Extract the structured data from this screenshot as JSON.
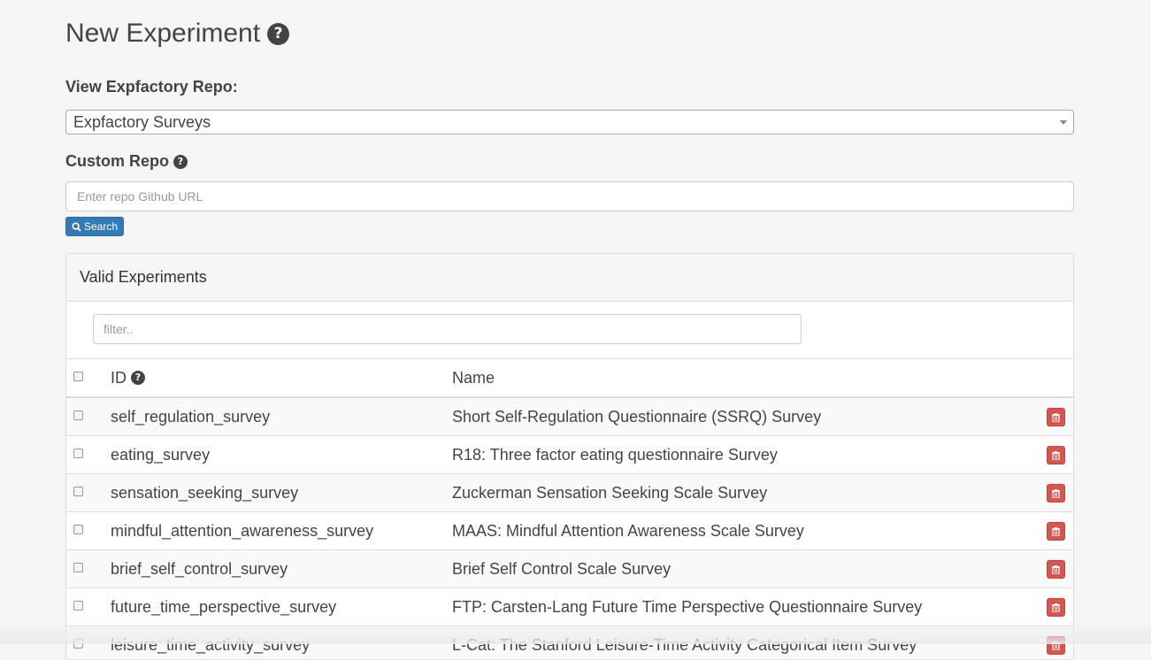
{
  "page": {
    "title": "New Experiment",
    "title_help_icon": "question-circle-icon"
  },
  "repo": {
    "label": "View Expfactory Repo:",
    "selected": "Expfactory Surveys"
  },
  "custom_repo": {
    "label": "Custom Repo",
    "help_icon": "question-circle-icon",
    "placeholder": "Enter repo Github URL",
    "search_label": "Search"
  },
  "panel": {
    "title": "Valid Experiments",
    "filter_placeholder": "filter.."
  },
  "table": {
    "columns": {
      "id": "ID",
      "name": "Name"
    },
    "rows": [
      {
        "id": "self_regulation_survey",
        "name": "Short Self-Regulation Questionnaire (SSRQ) Survey"
      },
      {
        "id": "eating_survey",
        "name": "R18: Three factor eating questionnaire Survey"
      },
      {
        "id": "sensation_seeking_survey",
        "name": "Zuckerman Sensation Seeking Scale Survey"
      },
      {
        "id": "mindful_attention_awareness_survey",
        "name": "MAAS: Mindful Attention Awareness Scale Survey"
      },
      {
        "id": "brief_self_control_survey",
        "name": "Brief Self Control Scale Survey"
      },
      {
        "id": "future_time_perspective_survey",
        "name": "FTP: Carsten-Lang Future Time Perspective Questionnaire Survey"
      },
      {
        "id": "leisure_time_activity_survey",
        "name": "L-Cat: The Stanford Leisure-Time Activity Categorical Item Survey"
      }
    ]
  },
  "colors": {
    "primary": "#337ab7",
    "danger": "#d9534f",
    "background": "#f5f5f5"
  }
}
